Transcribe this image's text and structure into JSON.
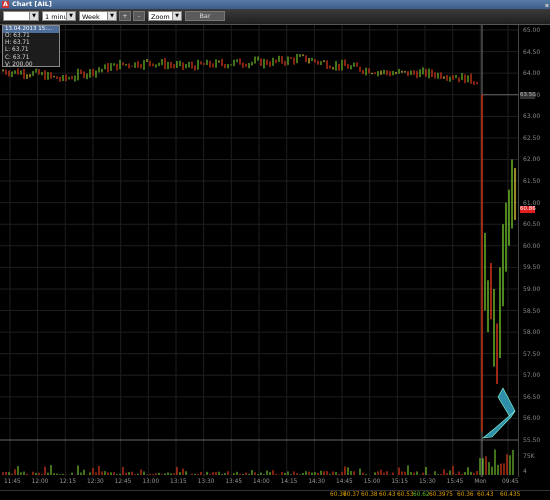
{
  "window": {
    "title": "Chart [AIL]"
  },
  "toolbar": {
    "symbol": "",
    "interval": "1 minute",
    "range": "Week",
    "plus": "+",
    "minus": "-",
    "zoom": "Zoom",
    "style": "Bar"
  },
  "info_box": {
    "date": "13.04.2013 15:...",
    "open": "O: 63.71",
    "high": "H: 63.71",
    "low": "L: 63.71",
    "close": "C: 63.71",
    "volume": "V: 200.00"
  },
  "y_axis": {
    "ticks": [
      "65.00",
      "64.50",
      "64.00",
      "63.50",
      "63.00",
      "62.50",
      "62.00",
      "61.50",
      "61.00",
      "60.50",
      "60.00",
      "59.50",
      "59.00",
      "58.50",
      "58.00",
      "57.50",
      "57.00",
      "56.50",
      "56.00",
      "55.50"
    ],
    "current_price": "60.86",
    "marker_price": "63.50",
    "volume_label": "75K",
    "volume_label2": "4"
  },
  "x_axis": {
    "ticks": [
      "11:45",
      "12:00",
      "12:15",
      "12:30",
      "12:45",
      "13:00",
      "13:15",
      "13:30",
      "13:45",
      "14:00",
      "14:15",
      "14:30",
      "14:45",
      "15:00",
      "15:15",
      "15:30",
      "15:45",
      "Mon",
      "09:45"
    ]
  },
  "footer": {
    "values": [
      "60.37",
      "60.37",
      "60.38",
      "60.43",
      "60.53",
      "60.62",
      "60.3975",
      "60.36",
      "60.43",
      "60.435"
    ],
    "colors": [
      "#e0a000",
      "#e0a000",
      "#e0a000",
      "#e0a000",
      "#e0a000",
      "#60c030",
      "#e0a000",
      "#e0a000",
      "#e0a000",
      "#e0a000"
    ]
  },
  "colors": {
    "up": "#6fbf2a",
    "down": "#e03a1a",
    "neutral": "#d8c23a",
    "arrow": "#2f8fa8"
  },
  "chart_data": {
    "type": "bar",
    "style": "OHLC bars",
    "ylim": [
      55.5,
      65.0
    ],
    "note_series": "price path",
    "x": [
      "11:45",
      "12:00",
      "12:15",
      "12:30",
      "12:45",
      "13:00",
      "13:15",
      "13:30",
      "13:45",
      "14:00",
      "14:15",
      "14:30",
      "14:45",
      "15:00",
      "15:15",
      "15:30",
      "15:45",
      "Mon",
      "09:45"
    ],
    "series": [
      {
        "values": [
          64.05,
          64.0,
          63.85,
          64.05,
          64.2,
          64.25,
          64.15,
          64.2,
          64.25,
          64.25,
          64.35,
          64.2,
          64.1,
          64.0,
          64.0,
          63.95,
          63.8,
          60.3,
          61.5
        ]
      }
    ],
    "grid": true
  }
}
